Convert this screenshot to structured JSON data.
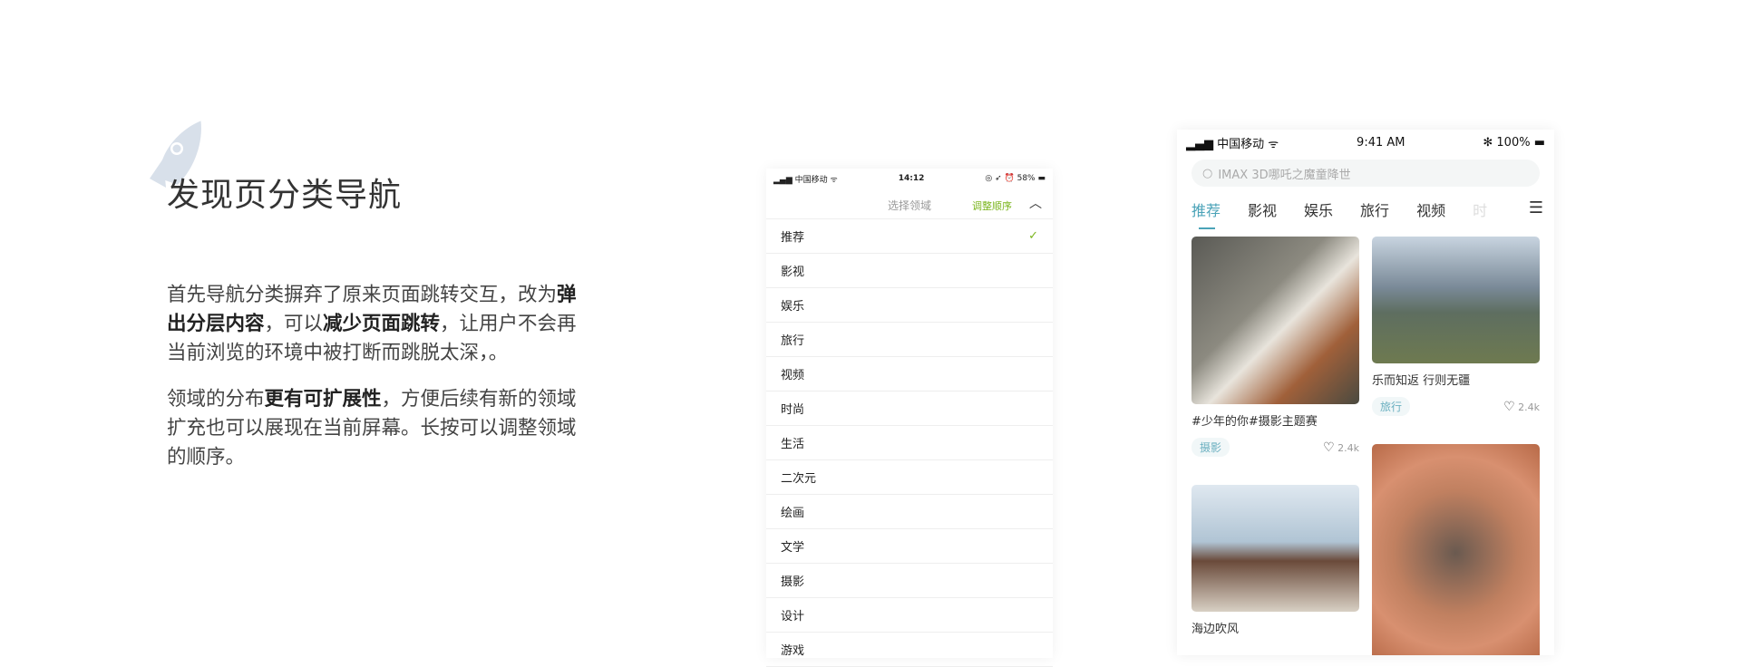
{
  "title": "发现页分类导航",
  "p1": {
    "a": "首先导航分类摒弃了原来页面跳转交互，改为",
    "b1": "弹出分层内容",
    "c": "，可以",
    "b2": "减少页面跳转",
    "d": "，让用户不会再当前浏览的环境中被打断而跳脱太深，。"
  },
  "p2": {
    "a": "领域的分布",
    "b": "更有可扩展性",
    "c": "，方便后续有新的领域扩充也可以展现在当前屏幕。长按可以调整领域的顺序。"
  },
  "phone1": {
    "carrier": "中国移动",
    "time": "14:12",
    "battery": "58%",
    "header": "选择领域",
    "adjust": "调整顺序",
    "rows": [
      "推荐",
      "影视",
      "娱乐",
      "旅行",
      "视频",
      "时尚",
      "生活",
      "二次元",
      "绘画",
      "文学",
      "摄影",
      "设计",
      "游戏"
    ]
  },
  "phone2": {
    "carrier": "中国移动",
    "time": "9:41 AM",
    "battery": "100%",
    "search_placeholder": "IMAX 3D哪吒之魔童降世",
    "tabs": [
      "推荐",
      "影视",
      "娱乐",
      "旅行",
      "视频",
      "时"
    ],
    "cards": [
      {
        "caption": "#少年的你#摄影主题赛",
        "tag": "摄影",
        "likes": "2.4k"
      },
      {
        "caption": "乐而知返 行则无疆",
        "tag": "旅行",
        "likes": "2.4k"
      },
      {
        "caption": "海边吹风"
      }
    ]
  },
  "colors": {
    "accent": "#4ba3b8",
    "green": "#7ab51d"
  }
}
